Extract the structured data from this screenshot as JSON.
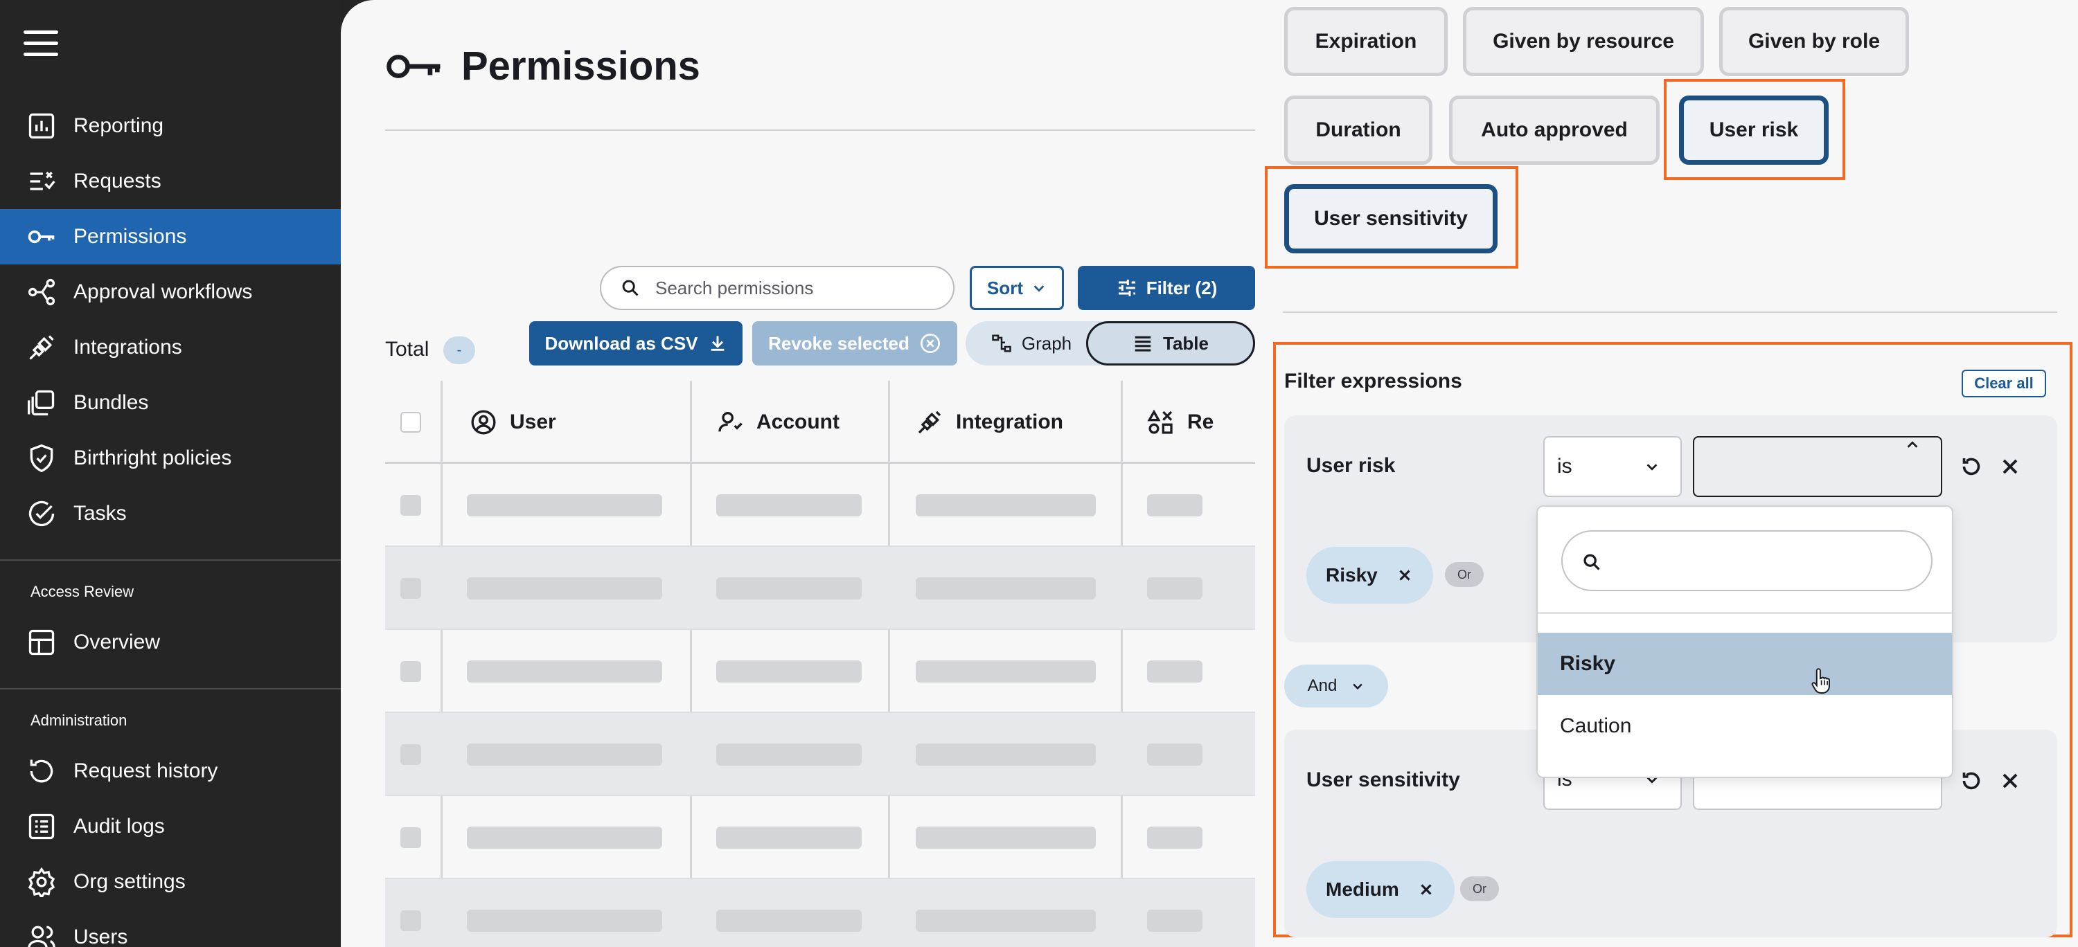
{
  "sidebar": {
    "nav": [
      {
        "label": "Reporting",
        "icon": "bar-chart-icon"
      },
      {
        "label": "Requests",
        "icon": "checklist-icon"
      },
      {
        "label": "Permissions",
        "icon": "key-icon"
      },
      {
        "label": "Approval workflows",
        "icon": "workflow-icon"
      },
      {
        "label": "Integrations",
        "icon": "plug-icon"
      },
      {
        "label": "Bundles",
        "icon": "bundle-icon"
      },
      {
        "label": "Birthright policies",
        "icon": "shield-icon"
      },
      {
        "label": "Tasks",
        "icon": "check-circle-icon"
      }
    ],
    "access_review_heading": "Access Review",
    "access_review_item": "Overview",
    "administration_heading": "Administration",
    "admin": [
      {
        "label": "Request history",
        "icon": "history-icon"
      },
      {
        "label": "Audit logs",
        "icon": "list-icon"
      },
      {
        "label": "Org settings",
        "icon": "gear-icon"
      },
      {
        "label": "Users",
        "icon": "users-icon"
      }
    ]
  },
  "main": {
    "title": "Permissions",
    "search_placeholder": "Search permissions",
    "sort_label": "Sort",
    "filter_label": "Filter (2)",
    "total_label": "Total",
    "total_value": "-",
    "download_label": "Download as CSV",
    "revoke_label": "Revoke selected",
    "view_graph": "Graph",
    "view_table": "Table",
    "columns": [
      "User",
      "Account",
      "Integration",
      "Re"
    ]
  },
  "panel": {
    "chips": [
      "Expiration",
      "Given by resource",
      "Given by role",
      "Duration",
      "Auto approved",
      "User risk",
      "User sensitivity"
    ],
    "filter_expressions_title": "Filter expressions",
    "clear_all": "Clear all",
    "conditions": [
      {
        "field": "User risk",
        "operator": "is",
        "value": "",
        "tokens": [
          "Risky"
        ],
        "or_label": "Or"
      },
      {
        "field": "User sensitivity",
        "operator": "is",
        "value": "",
        "tokens": [
          "Medium"
        ],
        "or_label": "Or"
      }
    ],
    "connector": "And",
    "dropdown": {
      "search_value": "",
      "options": [
        "Risky",
        "Caution"
      ],
      "highlighted": "Risky"
    }
  },
  "colors": {
    "accent": "#1c5a97",
    "active_nav": "#1f65b0",
    "highlight": "#f26a21"
  }
}
